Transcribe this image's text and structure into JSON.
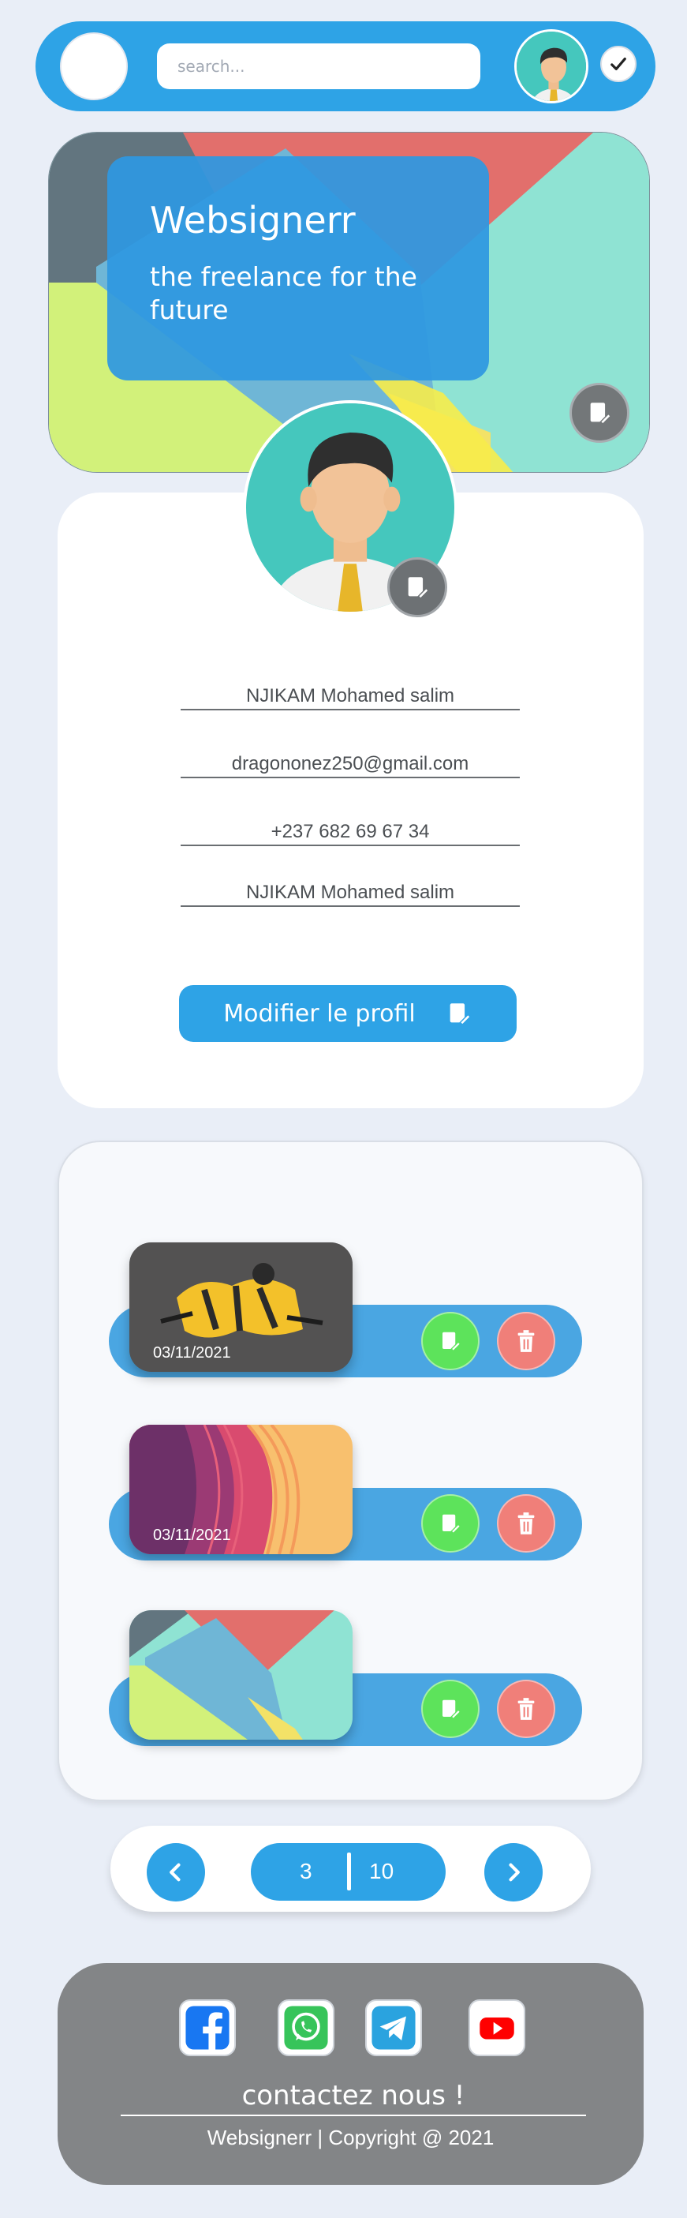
{
  "header": {
    "search_placeholder": "search...",
    "logo_icon": "blank-logo-circle",
    "avatar_icon": "user-avatar-icon",
    "confirm_icon": "checkmark-icon"
  },
  "banner": {
    "title": "Websignerr",
    "subtitle": "the freelance for the future",
    "edit_icon": "edit-icon"
  },
  "profile": {
    "name": "NJIKAM Mohamed salim",
    "email": "dragononez250@gmail.com",
    "phone": "+237 682 69 67 34",
    "extra": "NJIKAM Mohamed salim",
    "modify_label": "Modifier le profil"
  },
  "projects": [
    {
      "date": "03/11/2021",
      "thumb": "graffiti"
    },
    {
      "date": "03/11/2021",
      "thumb": "waves"
    },
    {
      "date": "",
      "thumb": "material"
    }
  ],
  "pagination": {
    "current": "3",
    "total": "10"
  },
  "footer": {
    "contact_label": "contactez nous !",
    "copyright": "Websignerr | Copyright @ 2021",
    "socials": [
      "facebook-icon",
      "whatsapp-icon",
      "telegram-icon",
      "youtube-icon"
    ]
  },
  "colors": {
    "accent": "#2ea3e6",
    "edit": "#5de35b",
    "delete": "#f07f79",
    "footer": "#838587",
    "background": "#e9eef7"
  }
}
